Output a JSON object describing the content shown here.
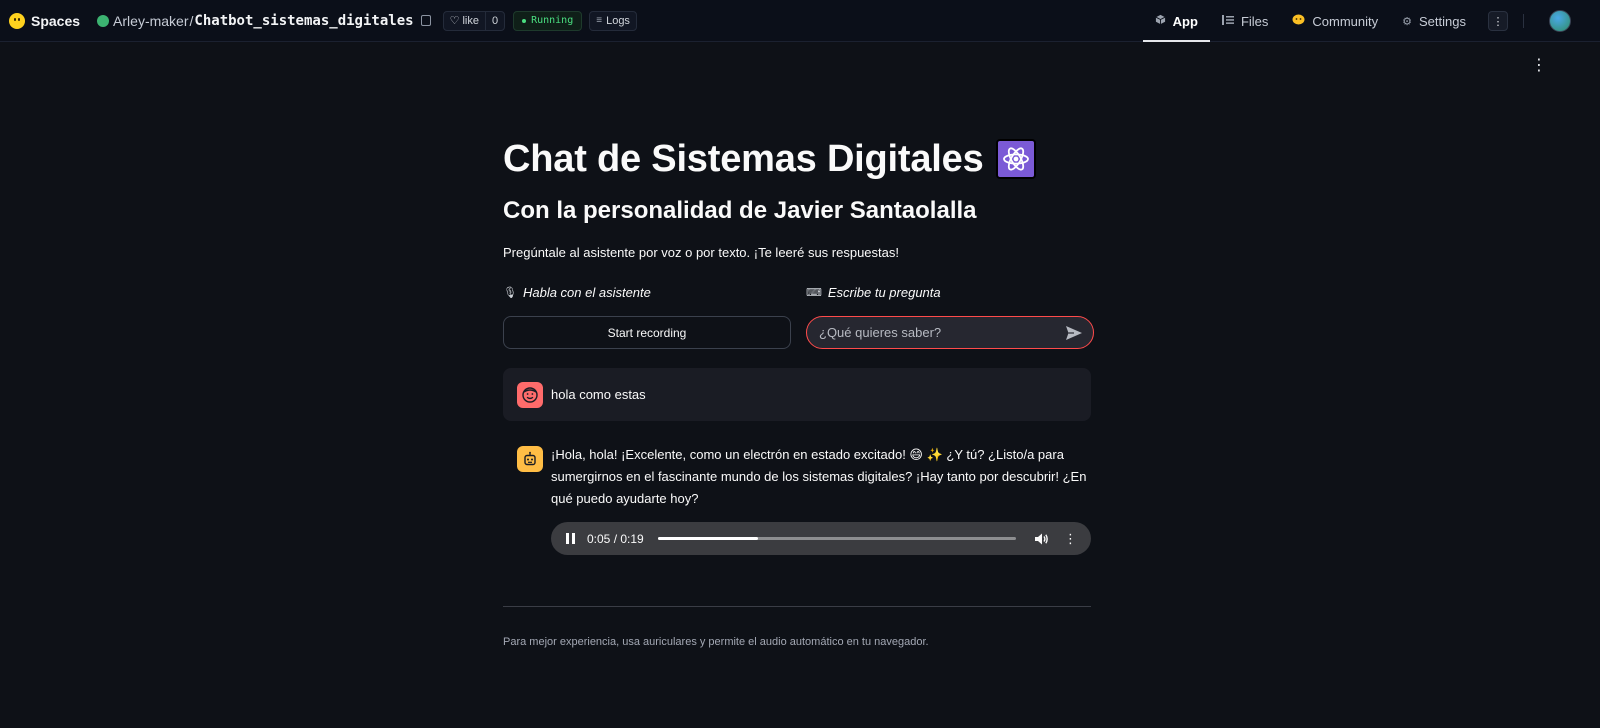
{
  "topbar": {
    "brand": "Spaces",
    "repo_owner": "Arley-maker",
    "repo_separator": "/",
    "repo_name": "Chatbot_sistemas_digitales",
    "like_label": "like",
    "like_count": "0",
    "status": "Running",
    "logs_label": "Logs",
    "nav": [
      {
        "label": "App",
        "icon": "cube-icon",
        "active": true
      },
      {
        "label": "Files",
        "icon": "files-icon",
        "active": false
      },
      {
        "label": "Community",
        "icon": "community-icon",
        "active": false
      },
      {
        "label": "Settings",
        "icon": "gear-icon",
        "active": false
      }
    ],
    "more_glyph": "⋮",
    "status_color": "#4ade80"
  },
  "page_menu_glyph": "⋮",
  "app": {
    "title": "Chat de Sistemas Digitales",
    "title_icon": "atom-icon",
    "subtitle": "Con la personalidad de Javier Santaolalla",
    "lead": "Pregúntale al asistente por voz o por texto. ¡Te leeré sus respuestas!",
    "voice_label": "Habla con el asistente",
    "voice_icon": "microphone-icon",
    "text_label": "Escribe tu pregunta",
    "text_icon": "keyboard-icon",
    "record_button": "Start recording",
    "chat_placeholder": "¿Qué quieres saber?",
    "accent_color": "#ff4b4b"
  },
  "messages": [
    {
      "role": "user",
      "avatar": "user-avatar-icon",
      "text": "hola como estas"
    },
    {
      "role": "assistant",
      "avatar": "bot-avatar-icon",
      "text": "¡Hola, hola! ¡Excelente, como un electrón en estado excitado! 😄 ✨ ¿Y tú? ¿Listo/a para sumergirnos en el fascinante mundo de los sistemas digitales? ¡Hay tanto por descubrir! ¿En qué puedo ayudarte hoy?"
    }
  ],
  "audio": {
    "time": "0:05 / 0:19",
    "progress": 0.28,
    "menu_glyph": "⋮"
  },
  "footnote": "Para mejor experiencia, usa auriculares y permite el audio automático en tu navegador."
}
